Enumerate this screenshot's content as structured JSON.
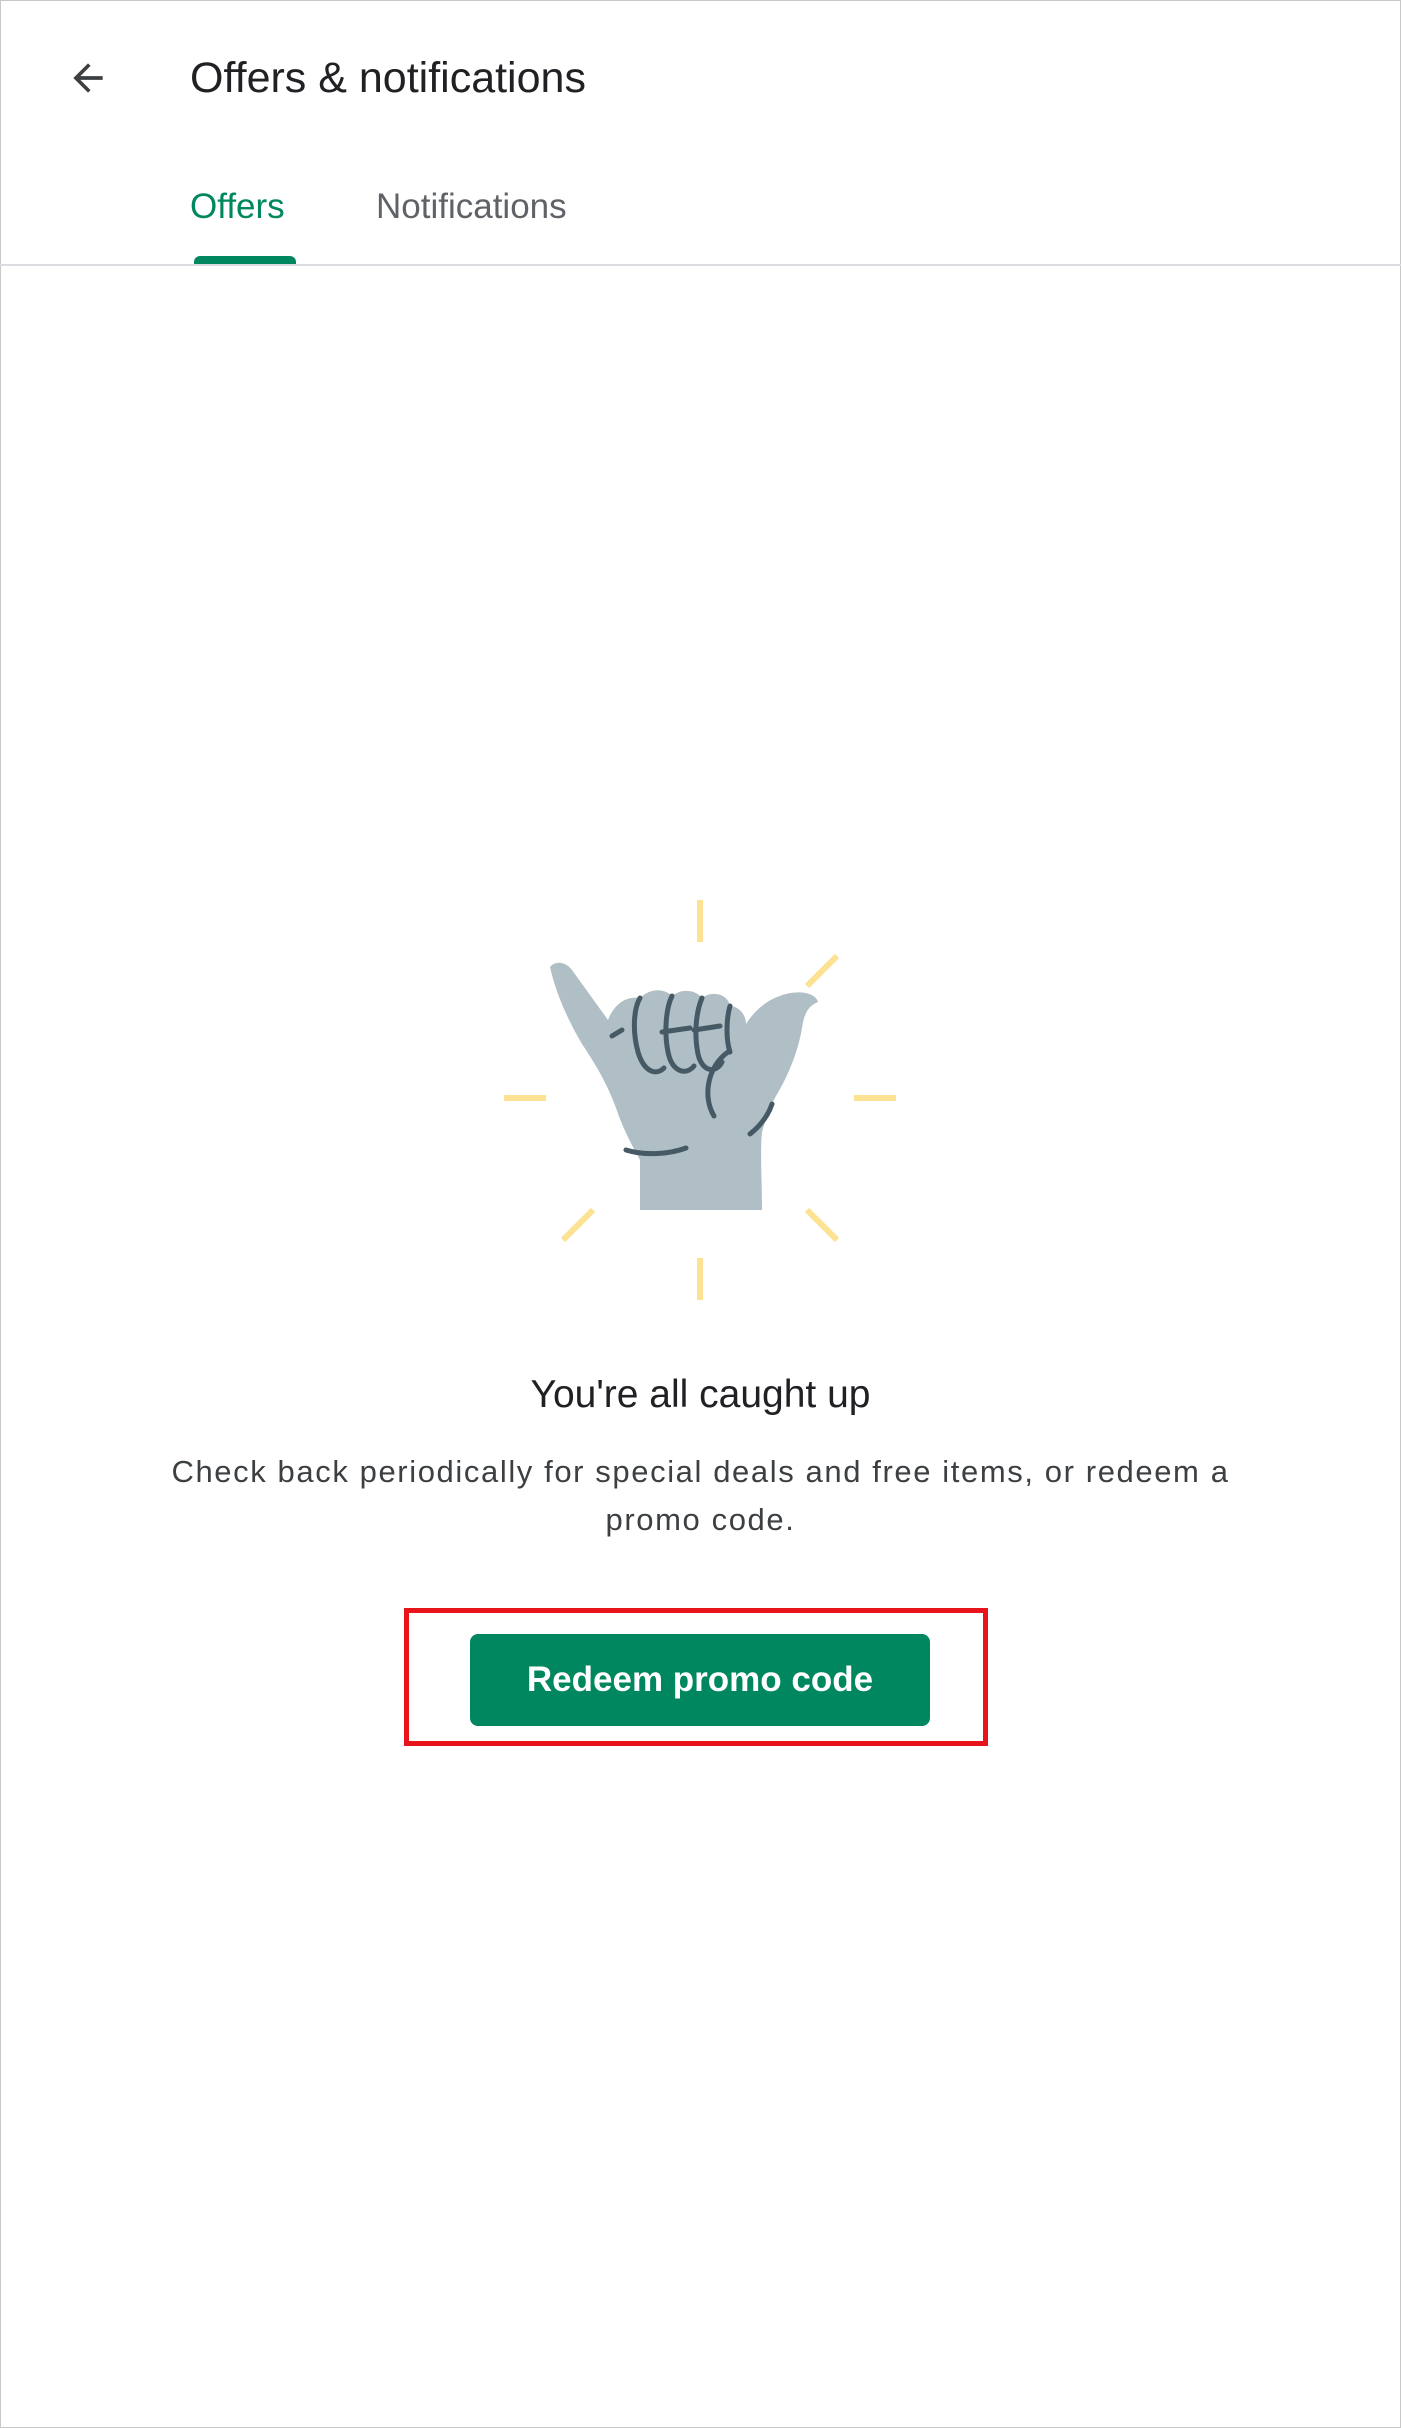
{
  "header": {
    "back_icon": "arrow-left-icon",
    "title": "Offers & notifications"
  },
  "tabs": [
    {
      "label": "Offers",
      "selected": true
    },
    {
      "label": "Notifications",
      "selected": false
    }
  ],
  "colors": {
    "accent": "#01875f",
    "illustration_hand": "#b0bec5",
    "illustration_outline": "#455a64",
    "illustration_rays": "#fde293",
    "highlight": "#e8141b"
  },
  "empty_state": {
    "illustration": "shaka-hand-icon",
    "title": "You're all caught up",
    "body": "Check back periodically for special deals and free items, or redeem a promo code."
  },
  "actions": {
    "redeem_label": "Redeem promo code"
  }
}
